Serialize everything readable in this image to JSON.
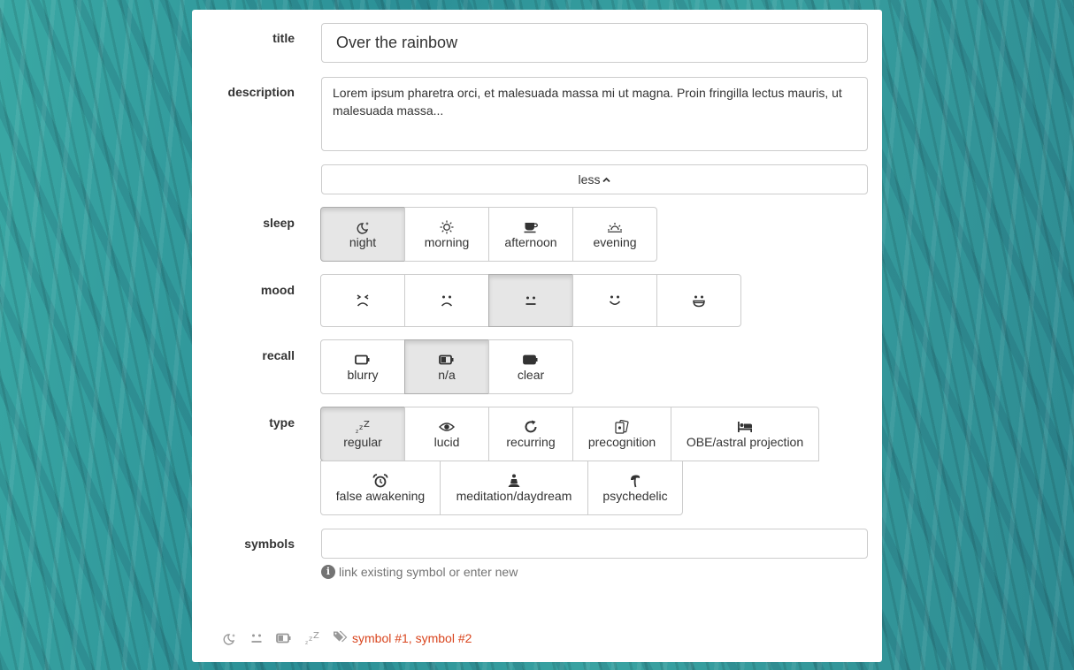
{
  "form": {
    "title_label": "title",
    "title_value": "Over the rainbow",
    "description_label": "description",
    "description_value": "Lorem ipsum pharetra orci, et malesuada massa mi ut magna. Proin fringilla lectus mauris, ut malesuada massa...",
    "less_label": "less",
    "sleep_label": "sleep",
    "sleep_options": [
      {
        "label": "night",
        "icon": "moon-stars-icon",
        "selected": true
      },
      {
        "label": "morning",
        "icon": "sun-icon",
        "selected": false
      },
      {
        "label": "afternoon",
        "icon": "coffee-cup-icon",
        "selected": false
      },
      {
        "label": "evening",
        "icon": "sunset-icon",
        "selected": false
      }
    ],
    "mood_label": "mood",
    "mood_options": [
      {
        "icon": "angry-face-icon",
        "selected": false
      },
      {
        "icon": "sad-face-icon",
        "selected": false
      },
      {
        "icon": "neutral-face-icon",
        "selected": true
      },
      {
        "icon": "smile-face-icon",
        "selected": false
      },
      {
        "icon": "grin-face-icon",
        "selected": false
      }
    ],
    "recall_label": "recall",
    "recall_options": [
      {
        "label": "blurry",
        "icon": "battery-empty-icon",
        "selected": false
      },
      {
        "label": "n/a",
        "icon": "battery-half-icon",
        "selected": true
      },
      {
        "label": "clear",
        "icon": "battery-full-icon",
        "selected": false
      }
    ],
    "type_label": "type",
    "type_options": [
      {
        "label": "regular",
        "icon": "zzz-icon",
        "selected": true
      },
      {
        "label": "lucid",
        "icon": "eye-icon",
        "selected": false
      },
      {
        "label": "recurring",
        "icon": "refresh-icon",
        "selected": false
      },
      {
        "label": "precognition",
        "icon": "cards-icon",
        "selected": false
      },
      {
        "label": "OBE/astral projection",
        "icon": "bed-icon",
        "selected": false
      },
      {
        "label": "false awakening",
        "icon": "alarm-clock-icon",
        "selected": false
      },
      {
        "label": "meditation/daydream",
        "icon": "meditation-icon",
        "selected": false
      },
      {
        "label": "psychedelic",
        "icon": "mushroom-icon",
        "selected": false
      }
    ],
    "symbols_label": "symbols",
    "symbols_value": "",
    "symbols_help": "link existing symbol or enter new",
    "help_icon": "i"
  },
  "footer": {
    "symbols_text": "symbol #1, symbol #2"
  },
  "colors": {
    "accent": "#d9451e",
    "active_bg": "#e6e6e6",
    "border": "#cccccc",
    "background": "#2e9a9a"
  }
}
